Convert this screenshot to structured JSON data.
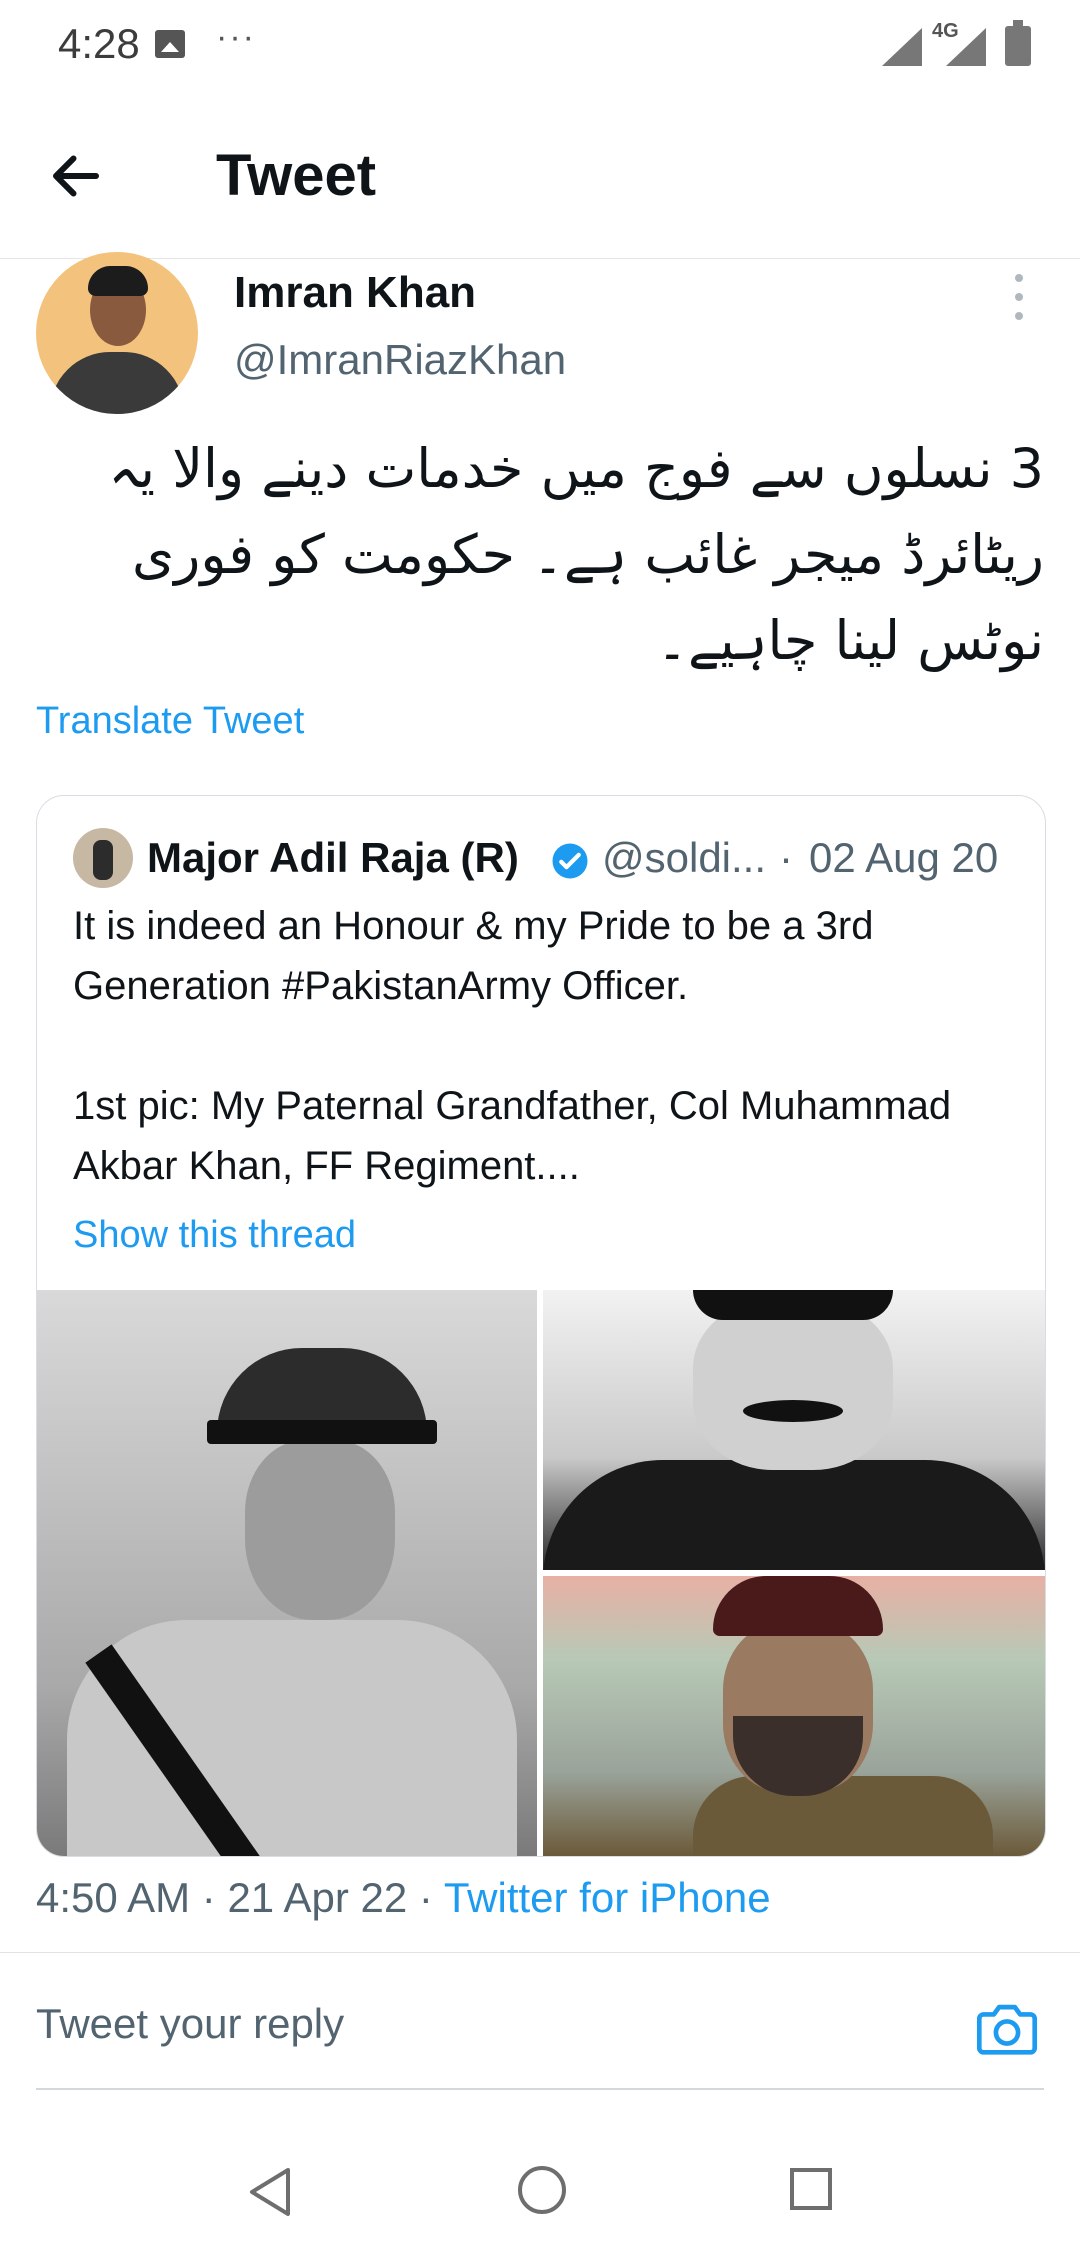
{
  "status_bar": {
    "time": "4:28",
    "more": "···",
    "network": "4G"
  },
  "header": {
    "title": "Tweet"
  },
  "tweet": {
    "author_name": "Imran Khan",
    "author_handle": "@ImranRiazKhan",
    "text": "3 نسلوں سے فوج میں خدمات دینے والا یہ ریٹائرڈ میجر غائب ہے۔ حکومت کو فوری نوٹس لینا چاہیے۔",
    "translate_label": "Translate Tweet",
    "time": "4:50 AM",
    "date": "21 Apr 22",
    "source": "Twitter for iPhone"
  },
  "quote": {
    "name": "Major Adil Raja (R)",
    "handle": "@soldi...",
    "date": "02 Aug 20",
    "line1": "It is indeed an Honour & my Pride to be a 3rd Generation #PakistanArmy Officer.",
    "line2": "1st pic: My Paternal Grandfather, Col Muhammad Akbar Khan, FF Regiment....",
    "thread_label": "Show this thread"
  },
  "reply": {
    "placeholder": "Tweet your reply"
  },
  "colors": {
    "accent": "#1d9bf0",
    "muted": "#536471",
    "text": "#0f1419"
  }
}
